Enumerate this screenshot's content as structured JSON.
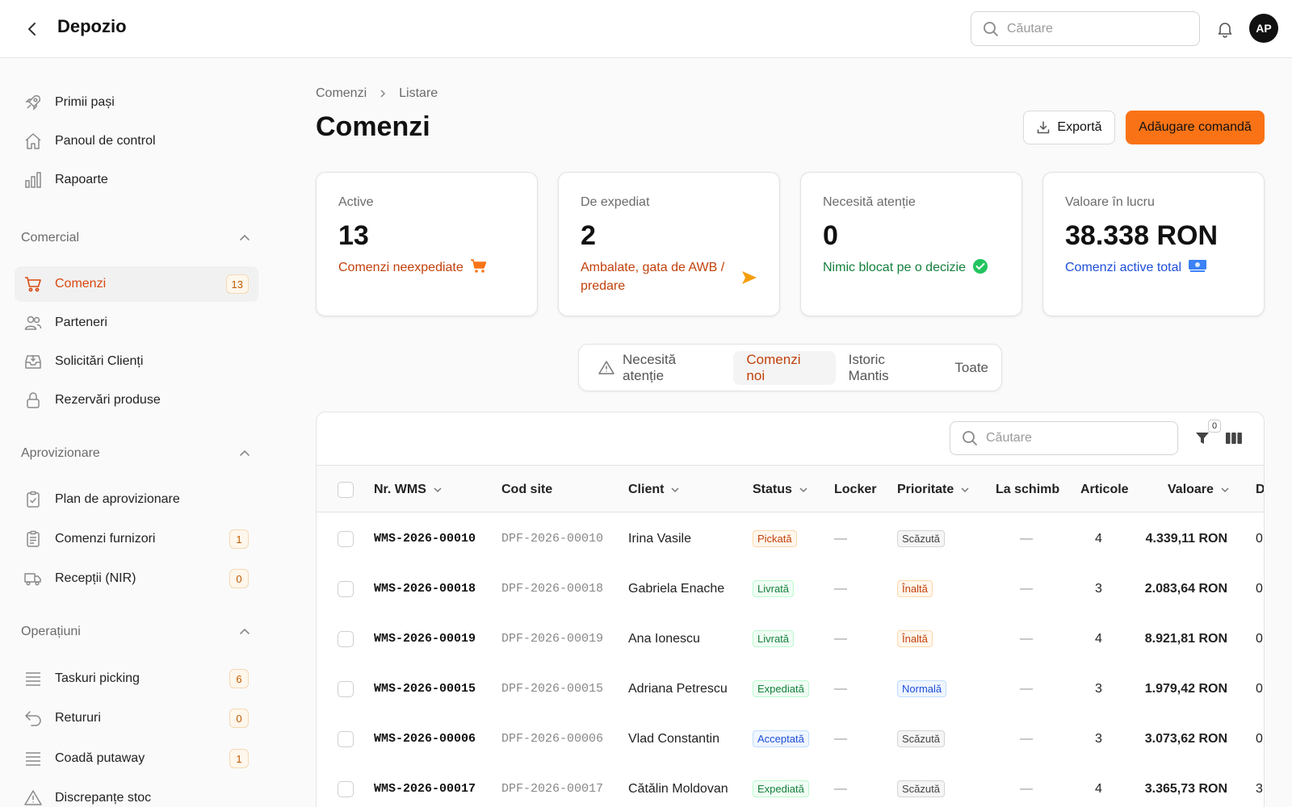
{
  "app": {
    "title": "Depozio",
    "avatar_initials": "AP",
    "search_placeholder": "Căutare"
  },
  "sidebar": {
    "top_items": [
      {
        "label": "Primii pași",
        "icon": "rocket-icon"
      },
      {
        "label": "Panoul de control",
        "icon": "home-icon"
      },
      {
        "label": "Rapoarte",
        "icon": "bar-chart-icon"
      }
    ],
    "sections": [
      {
        "title": "Comercial",
        "items": [
          {
            "label": "Comenzi",
            "icon": "cart-icon",
            "badge": "13",
            "active": true
          },
          {
            "label": "Parteneri",
            "icon": "users-icon"
          },
          {
            "label": "Solicitări Clienți",
            "icon": "inbox-icon"
          },
          {
            "label": "Rezervări produse",
            "icon": "lock-icon"
          }
        ]
      },
      {
        "title": "Aprovizionare",
        "items": [
          {
            "label": "Plan de aprovizionare",
            "icon": "clipboard-check-icon"
          },
          {
            "label": "Comenzi furnizori",
            "icon": "clipboard-list-icon",
            "badge": "1"
          },
          {
            "label": "Recepții (NIR)",
            "icon": "truck-icon",
            "badge": "0"
          }
        ]
      },
      {
        "title": "Operațiuni",
        "items": [
          {
            "label": "Taskuri picking",
            "icon": "list-icon",
            "badge": "6"
          },
          {
            "label": "Retururi",
            "icon": "return-icon",
            "badge": "0"
          },
          {
            "label": "Coadă putaway",
            "icon": "list-icon",
            "badge": "1"
          },
          {
            "label": "Discrepanțe stoc",
            "icon": "warning-icon"
          }
        ]
      }
    ]
  },
  "breadcrumb": {
    "parent": "Comenzi",
    "current": "Listare"
  },
  "page": {
    "title": "Comenzi",
    "export_label": "Exportă",
    "add_label": "Adăugare comandă"
  },
  "cards": [
    {
      "title": "Active",
      "value": "13",
      "subtitle": "Comenzi neexpediate",
      "subtitle_color": "#c2410c",
      "icon": "cart-icon"
    },
    {
      "title": "De expediat",
      "value": "2",
      "subtitle": "Ambalate, gata de AWB / predare",
      "subtitle_color": "#c2410c",
      "icon": "send-icon"
    },
    {
      "title": "Necesită atenție",
      "value": "0",
      "subtitle": "Nimic blocat pe o decizie",
      "subtitle_color": "#15803d",
      "icon": "check-circle-icon"
    },
    {
      "title": "Valoare în lucru",
      "value": "38.338 RON",
      "subtitle": "Comenzi active total",
      "subtitle_color": "#1d4ed8",
      "icon": "money-icon"
    }
  ],
  "tabs": [
    {
      "label": "Necesită atenție",
      "icon": "warning-icon"
    },
    {
      "label": "Comenzi noi",
      "active": true
    },
    {
      "label": "Istoric Mantis"
    },
    {
      "label": "Toate"
    }
  ],
  "table": {
    "search_placeholder": "Căutare",
    "filter_count": "0",
    "columns": [
      "Nr. WMS",
      "Cod site",
      "Client",
      "Status",
      "Locker",
      "Prioritate",
      "La schimb",
      "Articole",
      "Valoare",
      "D"
    ],
    "rows": [
      {
        "wms": "WMS-2026-00010",
        "site": "DPF-2026-00010",
        "client": "Irina Vasile",
        "status": "Pickată",
        "locker": "—",
        "priority": "Scăzută",
        "exchange": "—",
        "items": "4",
        "value": "4.339,11 RON",
        "extra": "0"
      },
      {
        "wms": "WMS-2026-00018",
        "site": "DPF-2026-00018",
        "client": "Gabriela Enache",
        "status": "Livrată",
        "locker": "—",
        "priority": "Înaltă",
        "exchange": "—",
        "items": "3",
        "value": "2.083,64 RON",
        "extra": "0"
      },
      {
        "wms": "WMS-2026-00019",
        "site": "DPF-2026-00019",
        "client": "Ana Ionescu",
        "status": "Livrată",
        "locker": "—",
        "priority": "Înaltă",
        "exchange": "—",
        "items": "4",
        "value": "8.921,81 RON",
        "extra": "0"
      },
      {
        "wms": "WMS-2026-00015",
        "site": "DPF-2026-00015",
        "client": "Adriana Petrescu",
        "status": "Expediată",
        "locker": "—",
        "priority": "Normală",
        "exchange": "—",
        "items": "3",
        "value": "1.979,42 RON",
        "extra": "0"
      },
      {
        "wms": "WMS-2026-00006",
        "site": "DPF-2026-00006",
        "client": "Vlad Constantin",
        "status": "Acceptată",
        "locker": "—",
        "priority": "Scăzută",
        "exchange": "—",
        "items": "3",
        "value": "3.073,62 RON",
        "extra": "0"
      },
      {
        "wms": "WMS-2026-00017",
        "site": "DPF-2026-00017",
        "client": "Cătălin Moldovan",
        "status": "Expediată",
        "locker": "—",
        "priority": "Scăzută",
        "exchange": "—",
        "items": "4",
        "value": "3.365,73 RON",
        "extra": "3"
      }
    ]
  },
  "status_styles": {
    "Pickată": {
      "color": "#c2410c",
      "bg": "#fff7ed",
      "border": "#fed7aa"
    },
    "Livrată": {
      "color": "#15803d",
      "bg": "#f0fdf4",
      "border": "#bbf7d0"
    },
    "Expediată": {
      "color": "#15803d",
      "bg": "#f0fdf4",
      "border": "#bbf7d0"
    },
    "Acceptată": {
      "color": "#1d4ed8",
      "bg": "#eff6ff",
      "border": "#bfdbfe"
    }
  },
  "priority_styles": {
    "Scăzută": {
      "color": "#444444",
      "bg": "#f5f5f5",
      "border": "#d4d4d4"
    },
    "Înaltă": {
      "color": "#c2410c",
      "bg": "#fff7ed",
      "border": "#fed7aa"
    },
    "Normală": {
      "color": "#1d4ed8",
      "bg": "#eff6ff",
      "border": "#bfdbfe"
    }
  }
}
